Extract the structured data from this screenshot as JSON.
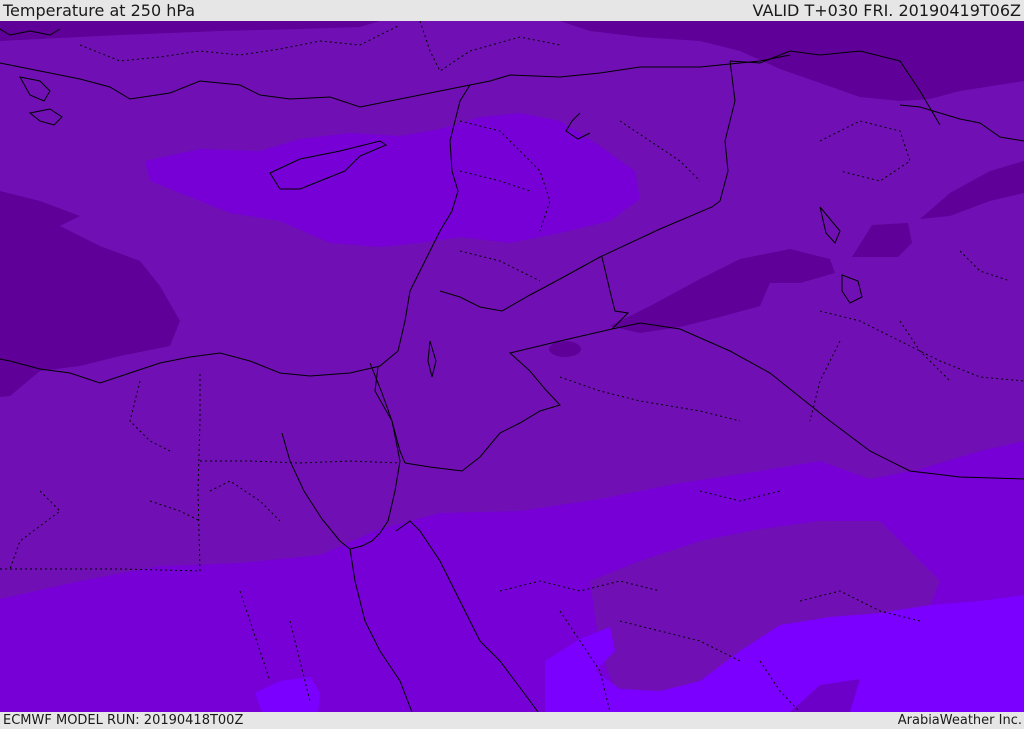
{
  "header": {
    "title": "Temperature at 250 hPa",
    "valid_time": "VALID T+030 FRI. 20190419T06Z"
  },
  "footer": {
    "model_run": "ECMWF MODEL RUN: 20190418T00Z",
    "credit": "ArabiaWeather Inc."
  },
  "colors": {
    "band_dark": "#5f0099",
    "band_mid": "#7010b4",
    "band_light": "#7600d6",
    "band_lightest": "#7b00ff",
    "boundary": "#000000"
  }
}
